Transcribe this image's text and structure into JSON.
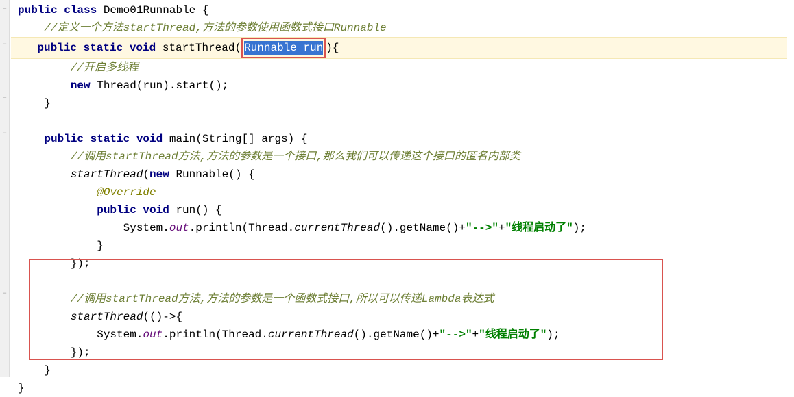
{
  "code": {
    "l1": {
      "kw1": "public class ",
      "cls": "Demo01Runnable",
      "brace": " {"
    },
    "l2": {
      "cmt": "//定义一个方法startThread,方法的参数使用函数式接口Runnable"
    },
    "l3": {
      "kw1": "public static void ",
      "method": "startThread",
      "paren1": "(",
      "sel": "Runnable run",
      "paren2": ")",
      "brace": "{"
    },
    "l4": {
      "cmt": "//开启多线程"
    },
    "l5": {
      "kw1": "new ",
      "cls": "Thread",
      "p1": "(",
      "arg": "run",
      "p2": ").",
      "start": "start",
      "p3": "();"
    },
    "l6": {
      "brace": "}"
    },
    "l7": {
      "kw1": "public static void ",
      "method": "main",
      "p1": "(String[] ",
      "arg": "args",
      "p2": ") {"
    },
    "l8": {
      "cmt": "//调用startThread方法,方法的参数是一个接口,那么我们可以传递这个接口的匿名内部类"
    },
    "l9": {
      "call": "startThread",
      "p1": "(",
      "kw": "new ",
      "cls": "Runnable",
      "p2": "() {"
    },
    "l10": {
      "annot": "@Override"
    },
    "l11": {
      "kw1": "public void ",
      "method": "run",
      "p": "() {"
    },
    "l12": {
      "sys": "System.",
      "out": "out",
      "pl": ".println(Thread.",
      "ct": "currentThread",
      "p2": "().getName()+",
      "s1": "\"-->\"",
      "plus": "+",
      "s2": "\"线程启动了\"",
      "p3": ");"
    },
    "l13": {
      "brace": "}"
    },
    "l14": {
      "brace": "});"
    },
    "l15": {
      "cmt": "//调用startThread方法,方法的参数是一个函数式接口,所以可以传递Lambda表达式"
    },
    "l16": {
      "call": "startThread",
      "p": "(()->{"
    },
    "l17": {
      "sys": "System.",
      "out": "out",
      "pl": ".println(Thread.",
      "ct": "currentThread",
      "p2": "().getName()+",
      "s1": "\"-->\"",
      "plus": "+",
      "s2": "\"线程启动了\"",
      "p3": ");"
    },
    "l18": {
      "brace": "});"
    },
    "l19": {
      "brace": "}"
    },
    "l20": {
      "brace": "}"
    }
  }
}
